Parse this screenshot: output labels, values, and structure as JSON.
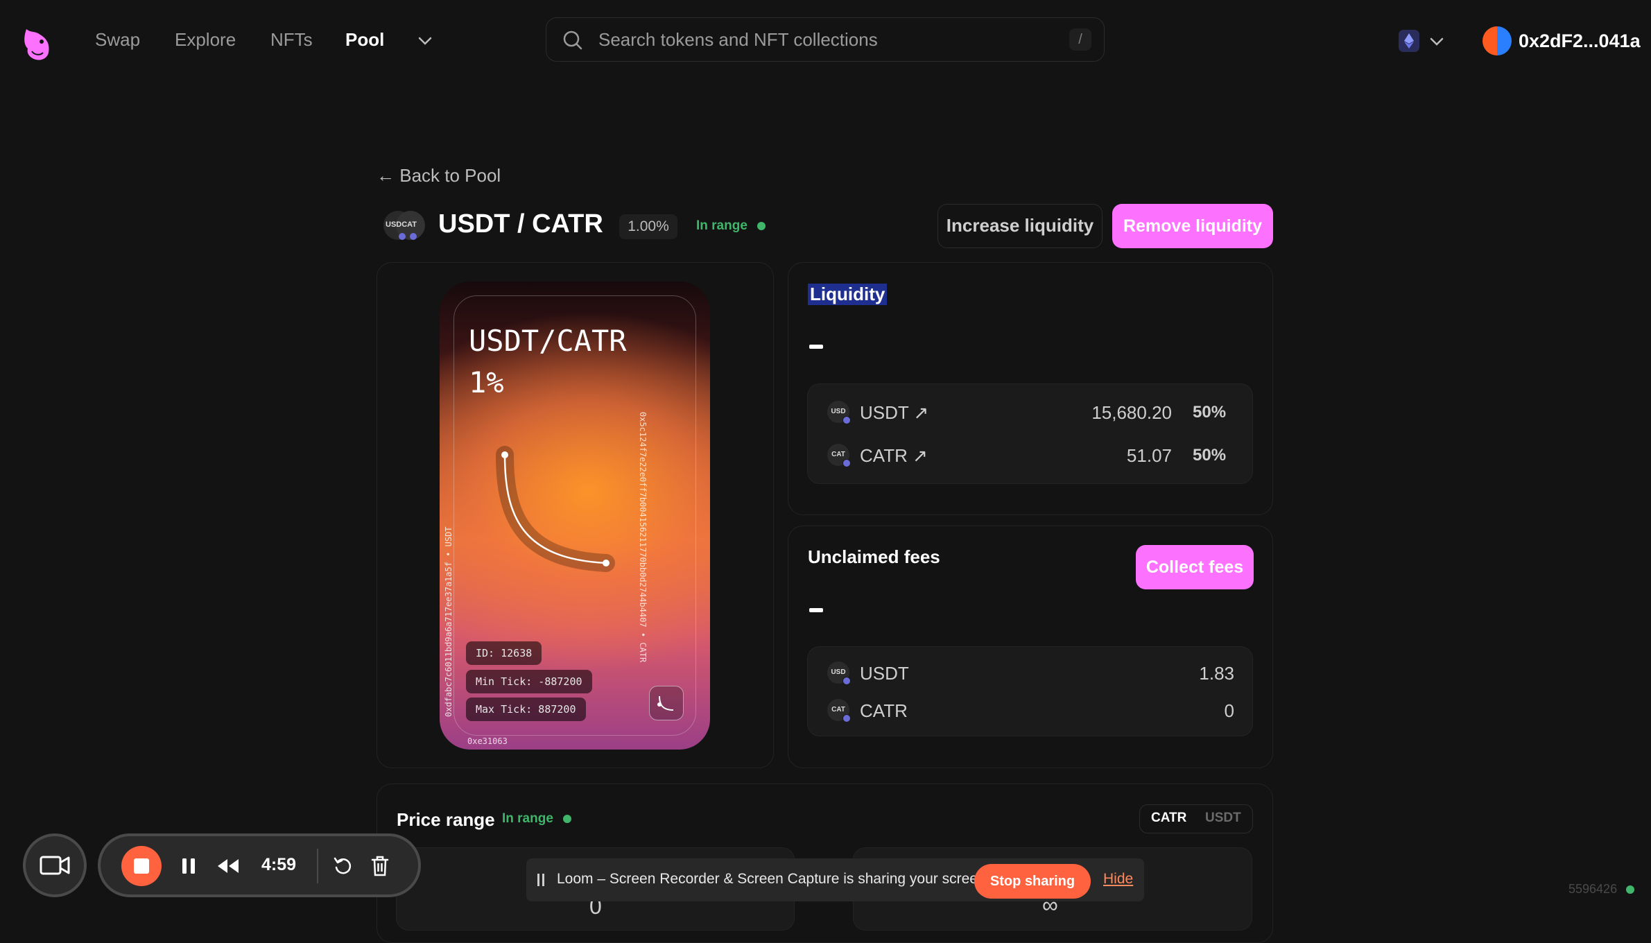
{
  "nav": {
    "links": [
      "Swap",
      "Explore",
      "NFTs",
      "Pool"
    ],
    "active": "Pool",
    "search_placeholder": "Search tokens and NFT collections",
    "search_shortcut": "/",
    "account": "0x2dF2...041a"
  },
  "header": {
    "back_label": "← Back to Pool",
    "pair_icon_text": "USDCAT",
    "pair": "USDT / CATR",
    "fee_tier": "1.00%",
    "status": "In range",
    "increase_label": "Increase liquidity",
    "remove_label": "Remove liquidity"
  },
  "nft": {
    "title": "USDT/CATR",
    "fee": "1%",
    "id": "ID: 12638",
    "min_tick": "Min Tick: -887200",
    "max_tick": "Max Tick: 887200",
    "top_edge": "0x5c124f7e22e0ff7b004156211770bb0d2744b4407 • CATR",
    "left_edge": "0xdfabc7c6011bd9a6a717ee37a1a5f • USDT",
    "bottom_edge": "0xe31063"
  },
  "liquidity": {
    "heading": "Liquidity",
    "value": "-",
    "tokens": [
      {
        "icon": "USD",
        "name": "USDT ↗",
        "amount": "15,680.20",
        "pct": "50%"
      },
      {
        "icon": "CAT",
        "name": "CATR ↗",
        "amount": "51.07",
        "pct": "50%"
      }
    ]
  },
  "fees": {
    "heading": "Unclaimed fees",
    "value": "-",
    "collect_label": "Collect fees",
    "tokens": [
      {
        "icon": "USD",
        "name": "USDT",
        "amount": "1.83"
      },
      {
        "icon": "CAT",
        "name": "CATR",
        "amount": "0"
      }
    ]
  },
  "price_range": {
    "heading": "Price range",
    "status": "In range",
    "toggle": [
      "CATR",
      "USDT"
    ],
    "active_toggle": "CATR",
    "min_peek": "0",
    "max_peek": "∞"
  },
  "loom": {
    "timer": "4:59",
    "share_text": "Loom – Screen Recorder & Screen Capture is sharing your screen.",
    "stop_sharing": "Stop sharing",
    "hide": "Hide"
  },
  "footer": {
    "block_number": "5596426"
  },
  "colors": {
    "accent_pink": "#fc72ff",
    "in_range_green": "#40b66b",
    "loom_orange": "#ff623e",
    "background": "#131313"
  }
}
